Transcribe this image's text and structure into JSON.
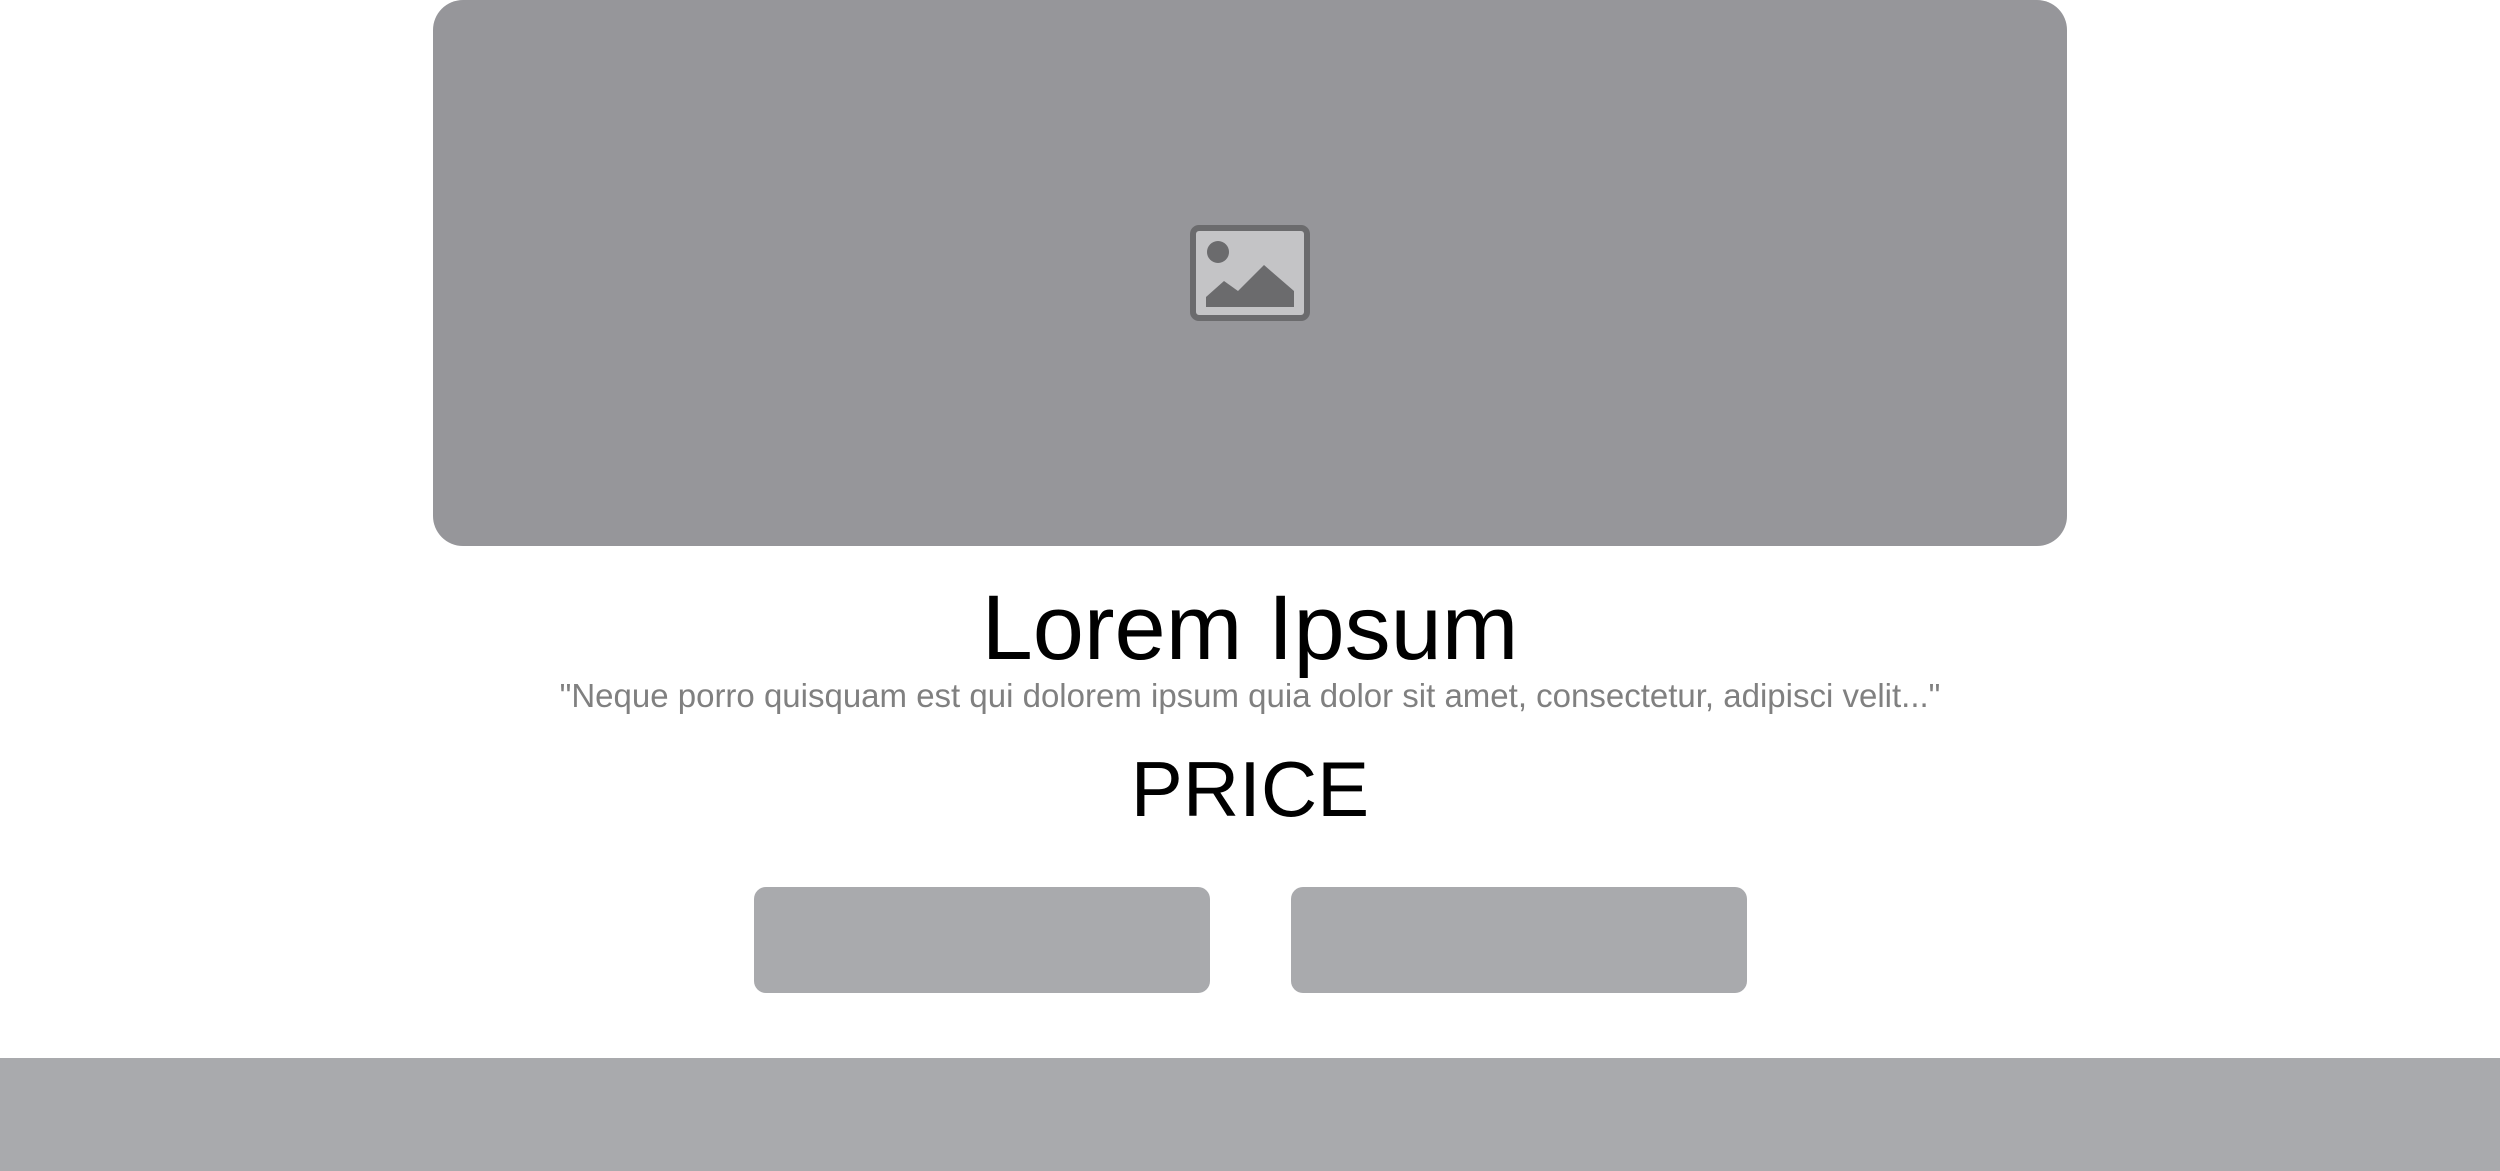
{
  "hero": {
    "icon": "image-placeholder-icon",
    "background_color": "#96969a"
  },
  "product": {
    "title": "Lorem Ipsum",
    "quote": "\"Neque porro quisquam est qui dolorem ipsum quia dolor sit amet, consectetur, adipisci velit...\"",
    "price_label": "PRICE"
  },
  "actions": {
    "primary_label": "",
    "secondary_label": "",
    "button_color": "#a9aaad"
  },
  "footer": {
    "color": "#a9aaad"
  }
}
